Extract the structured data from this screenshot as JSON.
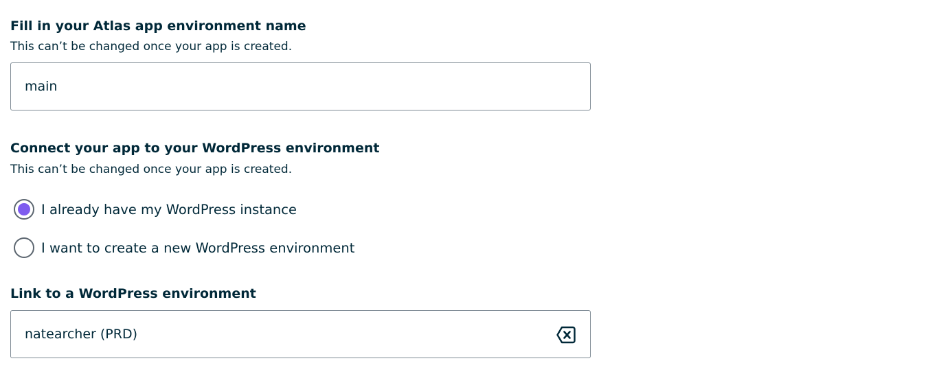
{
  "env_name": {
    "title": "Fill in your Atlas app environment name",
    "help": "This can’t be changed once your app is created.",
    "value": "main"
  },
  "connect": {
    "title": "Connect your app to your WordPress environment",
    "help": "This can’t be changed once your app is created.",
    "options": [
      {
        "label": "I already have my WordPress instance",
        "selected": true
      },
      {
        "label": "I want to create a new WordPress environment",
        "selected": false
      }
    ]
  },
  "link": {
    "title": "Link to a WordPress environment",
    "value": "natearcher (PRD)",
    "clear_icon": "backspace-x-icon"
  },
  "colors": {
    "text": "#002838",
    "accent": "#7e5cef",
    "border": "#7e8a94"
  }
}
